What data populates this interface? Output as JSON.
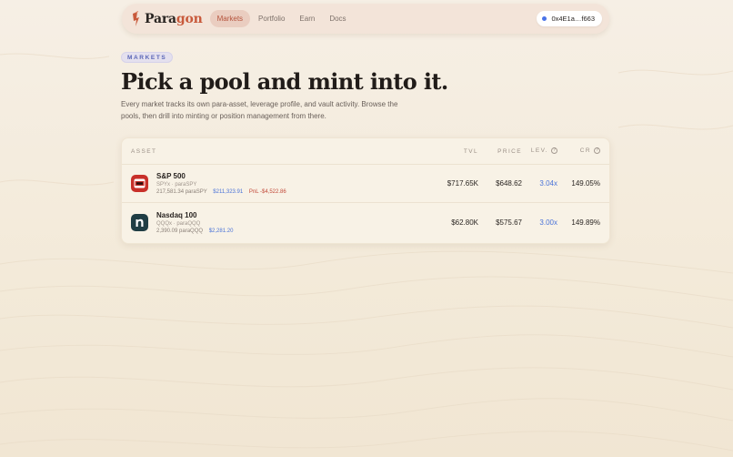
{
  "nav": {
    "brand_prefix": "Para",
    "brand_accent": "gon",
    "links": [
      "Markets",
      "Portfolio",
      "Earn",
      "Docs"
    ],
    "active_link": "Markets",
    "wallet_address": "0x4E1a…f663"
  },
  "header": {
    "badge": "MARKETS",
    "title": "Pick a pool and mint into it.",
    "subtitle": "Every market tracks its own para-asset, leverage profile, and vault activity. Browse the pools, then drill into minting or position management from there."
  },
  "table": {
    "columns": {
      "asset": "ASSET",
      "tvl": "TVL",
      "price": "PRICE",
      "lev": "LEV.",
      "cr": "CR"
    },
    "rows": [
      {
        "name": "S&P 500",
        "pair": "SPYx · paraSPY",
        "holdings": "217,581.34 paraSPY",
        "value": "$211,323.91",
        "pnl": "PnL -$4,522.86",
        "tvl": "$717.65K",
        "price": "$648.62",
        "lev": "3.04x",
        "cr": "149.05%",
        "icon": "sp500-icon",
        "icon_color": "#c8302a"
      },
      {
        "name": "Nasdaq 100",
        "pair": "QQQx · paraQQQ",
        "holdings": "2,390.09 paraQQQ",
        "value": "$2,281.20",
        "pnl": "",
        "tvl": "$62.80K",
        "price": "$575.67",
        "lev": "3.00x",
        "cr": "149.89%",
        "icon": "nasdaq-icon",
        "icon_color": "#1f3d44"
      }
    ]
  },
  "colors": {
    "accent": "#c85a3c",
    "link_blue": "#4a73d8",
    "negative": "#c24a3a"
  }
}
